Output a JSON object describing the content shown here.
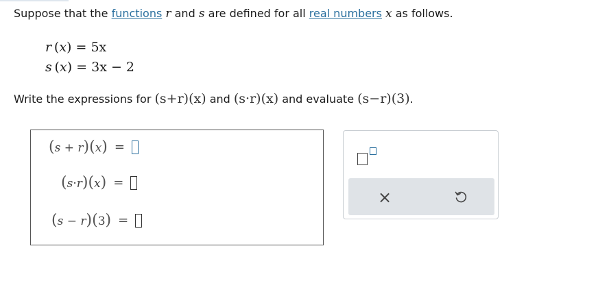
{
  "intro": {
    "t1": "Suppose that the ",
    "link1": "functions",
    "v1": "r",
    "t2": " and ",
    "v2": "s",
    "t3": " are defined for all ",
    "link2": "real numbers",
    "v3": "x",
    "t4": " as follows."
  },
  "definitions": [
    {
      "lhs": "r",
      "arg": "x",
      "rhs": "= 5x"
    },
    {
      "lhs": "s",
      "arg": "x",
      "rhs": "= 3x − 2"
    }
  ],
  "prompt": {
    "t1": "Write the expressions for ",
    "e1": "(s+r)(x)",
    "t2": " and ",
    "e2": "(s·r)(x)",
    "t3": " and evaluate ",
    "e3": "(s−r)(3)",
    "t4": "."
  },
  "answers": [
    {
      "f1": "s",
      "op": "+",
      "f2": "r",
      "arg": "x",
      "eq": "=",
      "value": ""
    },
    {
      "f1": "s",
      "op": "·",
      "f2": "r",
      "arg": "x",
      "eq": "=",
      "value": ""
    },
    {
      "f1": "s",
      "op": "−",
      "f2": "r",
      "arg": "3",
      "eq": "=",
      "value": ""
    }
  ],
  "tools": {
    "exponent_icon": "exponent-template-icon",
    "clear_icon": "close-icon",
    "undo_icon": "undo-icon",
    "clear_glyph": "×"
  },
  "colors": {
    "link": "#2a6f9e",
    "toolbar_bg": "#dfe3e7",
    "active_input": "#2a6f9e"
  }
}
